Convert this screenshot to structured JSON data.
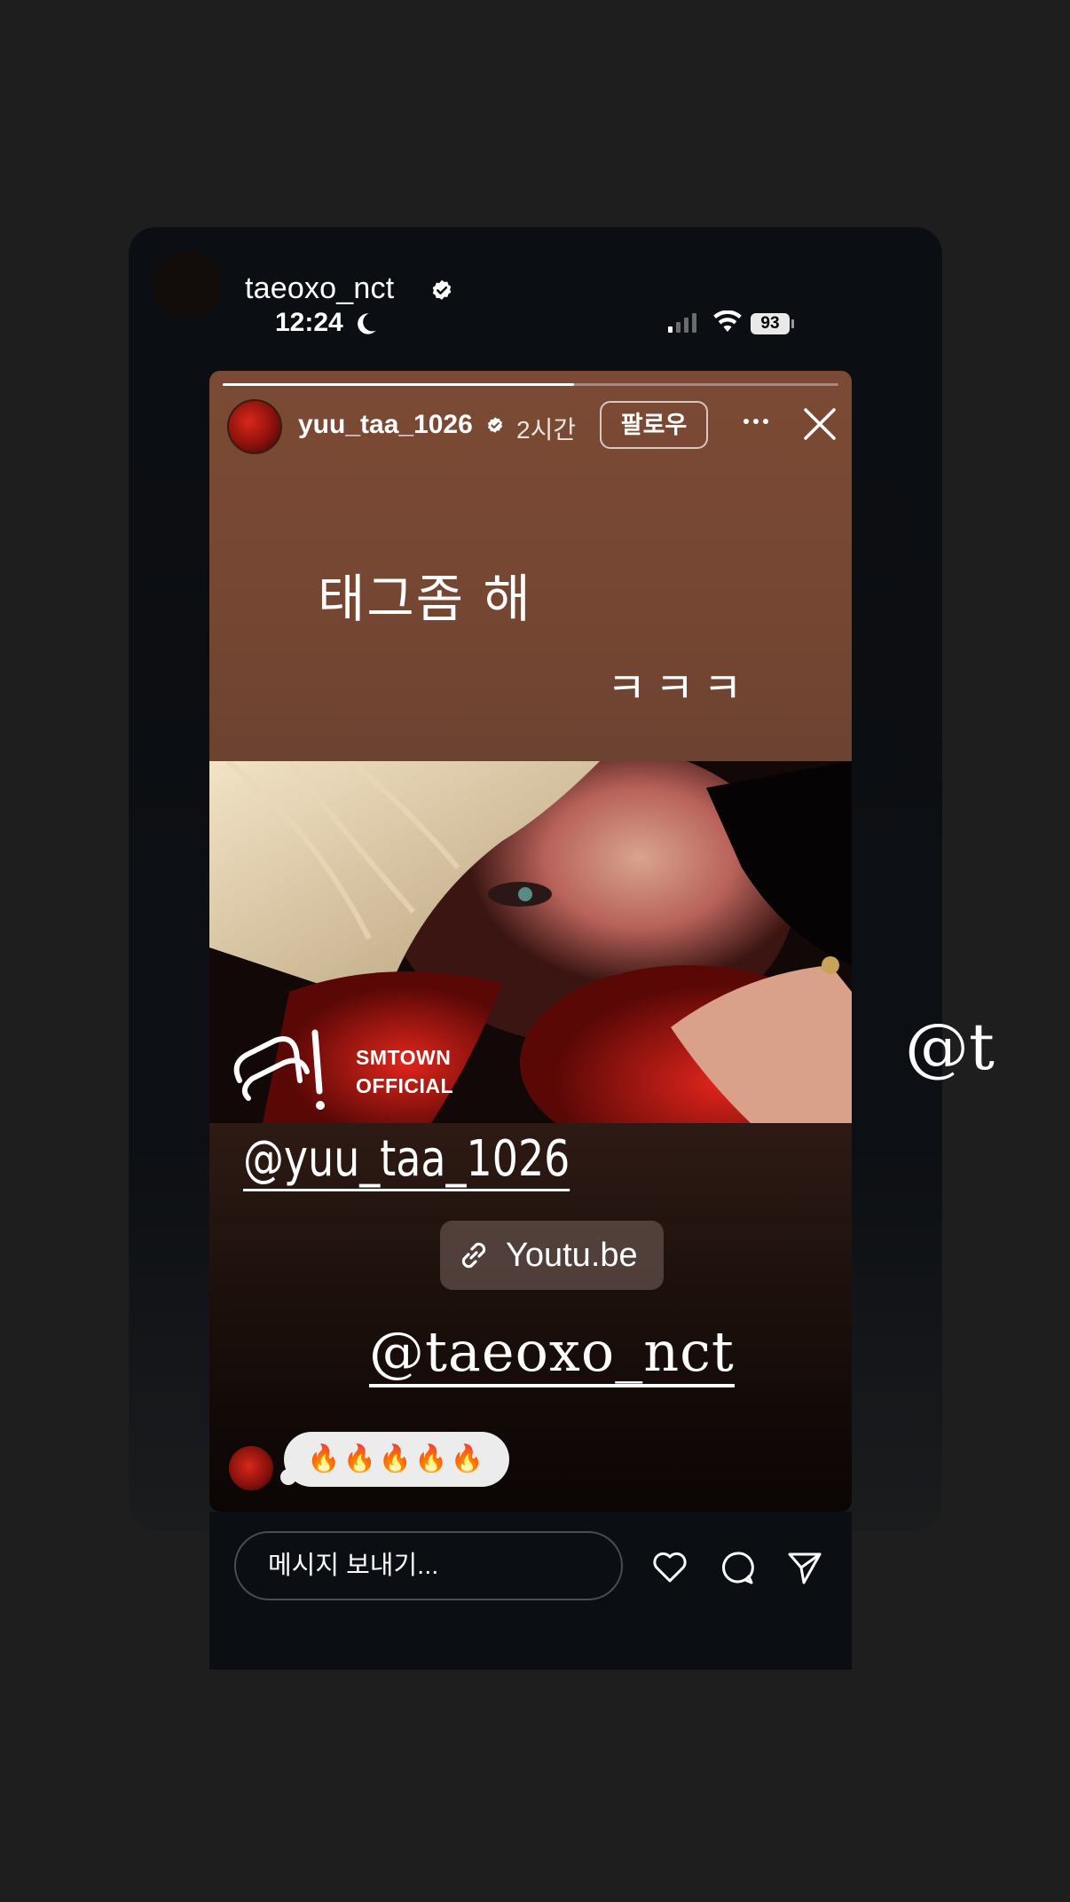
{
  "outer_story": {
    "username": "taeoxo_nct",
    "status_time": "12:24",
    "battery_level": "93",
    "side_mention_fragment": "@t"
  },
  "inner_story": {
    "username": "yuu_taa_1026",
    "time_ago": "2시간",
    "follow_label": "팔로우",
    "progress": 0.57,
    "caption_line1": "태그좀 해",
    "caption_line2": "ㅋㅋㅋ",
    "photo_watermark_line1": "SMTOWN",
    "photo_watermark_line2": "OFFICIAL",
    "mention_1": "@yuu_taa_1026",
    "link_sticker_label": "Youtu.be",
    "mention_2": "@taeoxo_nct",
    "reply_emojis": "🔥🔥🔥🔥🔥"
  },
  "bottom_bar": {
    "message_placeholder": "메시지 보내기..."
  },
  "icons": [
    "verified-badge-icon",
    "moon-icon",
    "signal-icon",
    "wifi-icon",
    "more-icon",
    "close-icon",
    "link-icon",
    "heart-icon",
    "comment-icon",
    "send-icon"
  ],
  "colors": {
    "background": "#1e1e1f",
    "story_top": "#7b4a35",
    "story_bottom": "#0b0504",
    "verified_badge": "#ffffff",
    "reply_bubble": "#ececec"
  }
}
